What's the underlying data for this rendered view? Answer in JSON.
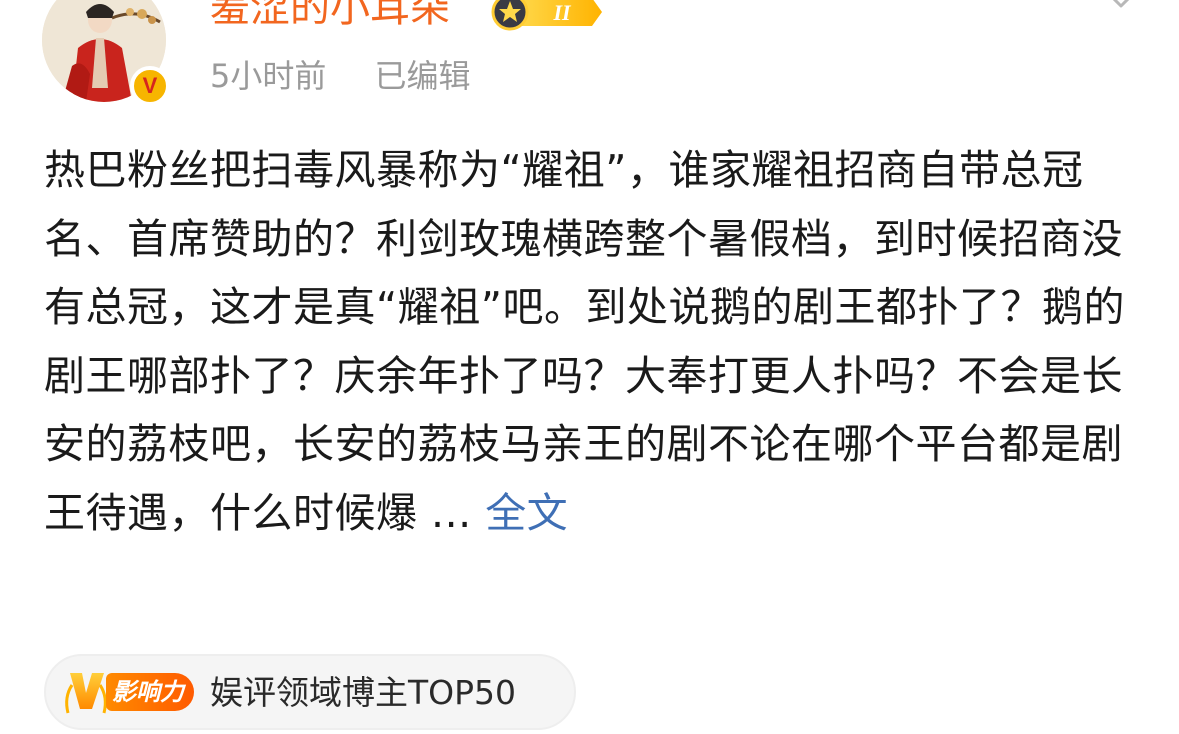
{
  "header": {
    "username": "羞涩的小耳朵",
    "level_badge": "II",
    "verified_mark": "V",
    "time": "5小时前",
    "edited": "已编辑"
  },
  "post": {
    "text": "热巴粉丝把扫毒风暴称为“耀祖”，谁家耀祖招商自带总冠名、首席赞助的？利剑玫瑰横跨整个暑假档，到时候招商没有总冠，这才是真“耀祖”吧。到处说鹅的剧王都扑了？鹅的剧王哪部扑了？庆余年扑了吗？大奉打更人扑吗？不会是长安的荔枝吧，长安的荔枝马亲王的剧不论在哪个平台都是剧王待遇，什么时候爆 ...",
    "more_link": "全文"
  },
  "influence": {
    "badge": "影响力",
    "label": "娱评领域博主TOP50"
  },
  "colors": {
    "username": "#f2661f",
    "link": "#3f6fb5",
    "meta": "#9a9a9a",
    "verified": "#f7b500"
  },
  "icons": [
    "avatar",
    "verified-icon",
    "level-badge-icon",
    "chevron-down-icon",
    "influence-v-icon"
  ]
}
